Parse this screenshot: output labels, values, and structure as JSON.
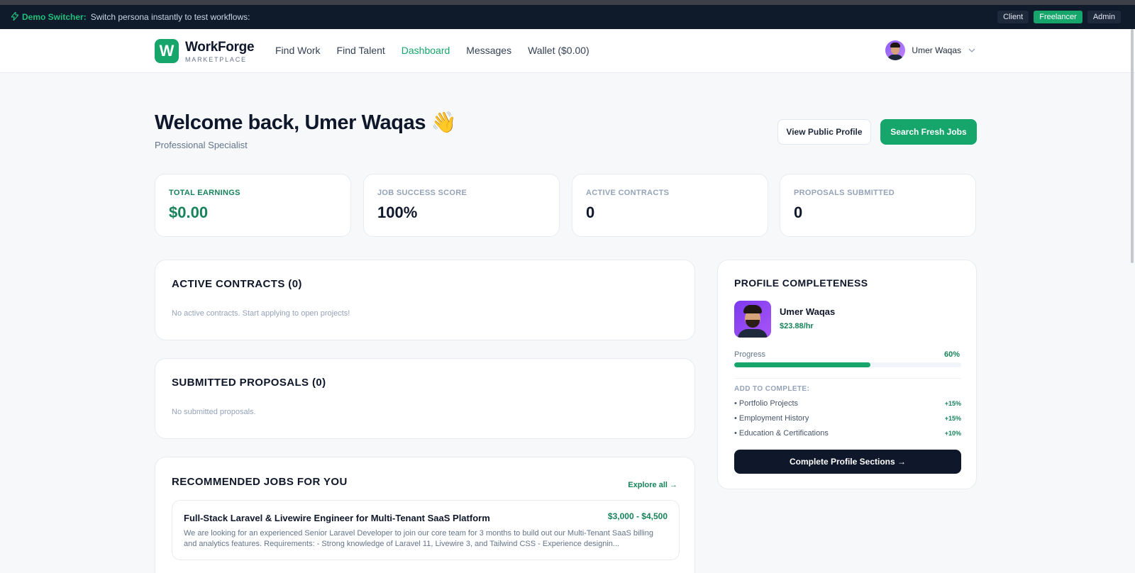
{
  "demo_bar": {
    "icon": "bolt-icon",
    "label": "Demo Switcher:",
    "text": "Switch persona instantly to test workflows:",
    "personas": [
      "Client",
      "Freelancer",
      "Admin"
    ],
    "active_persona": "Freelancer"
  },
  "nav": {
    "logo_letter": "W",
    "brand": "WorkForge",
    "brand_sub": "MARKETPLACE",
    "links": [
      "Find Work",
      "Find Talent",
      "Dashboard",
      "Messages",
      "Wallet ($0.00)"
    ],
    "active_link": "Dashboard",
    "user_name": "Umer Waqas",
    "chevron": "⌵"
  },
  "header": {
    "welcome": "Welcome back, Umer Waqas 👋",
    "subtitle": "Professional Specialist",
    "view_profile_label": "View Public Profile",
    "search_jobs_label": "Search Fresh Jobs"
  },
  "stats": [
    {
      "label": "TOTAL EARNINGS",
      "value": "$0.00"
    },
    {
      "label": "JOB SUCCESS SCORE",
      "value": "100%"
    },
    {
      "label": "ACTIVE CONTRACTS",
      "value": "0"
    },
    {
      "label": "PROPOSALS SUBMITTED",
      "value": "0"
    }
  ],
  "active_contracts": {
    "title": "ACTIVE CONTRACTS (0)",
    "empty": "No active contracts. Start applying to open projects!"
  },
  "submitted_proposals": {
    "title": "SUBMITTED PROPOSALS (0)",
    "empty": "No submitted proposals."
  },
  "recommended": {
    "title": "RECOMMENDED JOBS FOR YOU",
    "explore_label": "Explore all →",
    "jobs": [
      {
        "title": "Full-Stack Laravel & Livewire Engineer for Multi-Tenant SaaS Platform",
        "budget": "$3,000 - $4,500",
        "description": "We are looking for an experienced Senior Laravel Developer to join our core team for 3 months to build out our Multi-Tenant SaaS billing and analytics features. Requirements: - Strong knowledge of Laravel 11, Livewire 3, and Tailwind CSS - Experience designin..."
      }
    ]
  },
  "profile": {
    "title": "PROFILE COMPLETENESS",
    "name": "Umer Waqas",
    "rate": "$23.88/hr",
    "progress_label": "Progress",
    "progress_text": "60%",
    "progress_fraction": 0.6,
    "add_title": "ADD TO COMPLETE:",
    "items": [
      {
        "label": "• Portfolio Projects",
        "points": "+15%"
      },
      {
        "label": "• Employment History",
        "points": "+15%"
      },
      {
        "label": "• Education & Certifications",
        "points": "+10%"
      }
    ],
    "complete_label": "Complete Profile Sections →"
  },
  "colors": {
    "brand_green": "#16a56b",
    "dark": "#0f172a"
  }
}
